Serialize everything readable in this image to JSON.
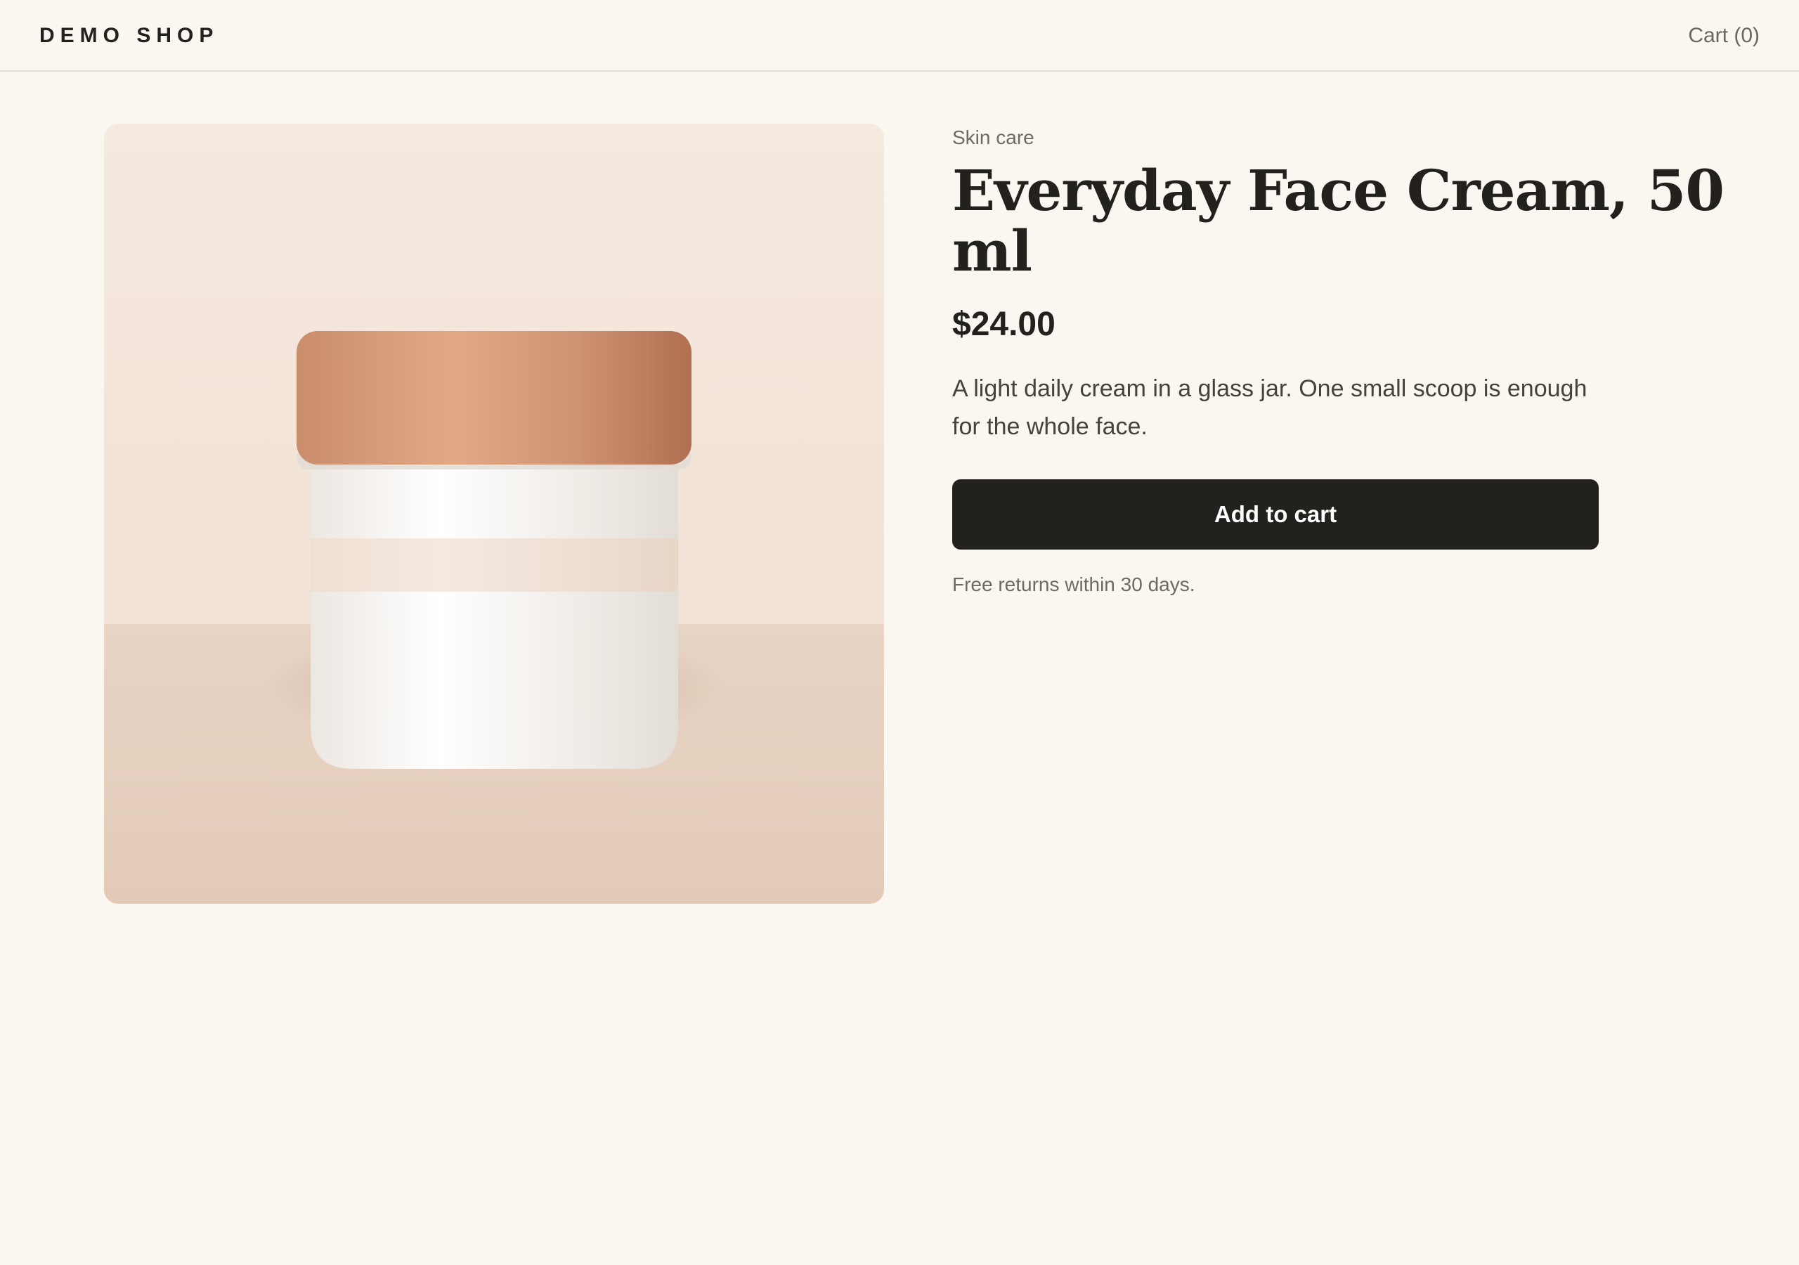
{
  "header": {
    "brand": "DEMO SHOP",
    "cart_label": "Cart (0)"
  },
  "product": {
    "category": "Skin care",
    "title": "Everyday Face Cream, 50 ml",
    "price": "$24.00",
    "description": "A light daily cream in a glass jar. One small scoop is enough for the whole face.",
    "add_to_cart_label": "Add to cart",
    "returns_note": "Free returns within 30 days."
  },
  "colors": {
    "background": "#faf7f1",
    "text": "#22211d",
    "button": "#22211d",
    "muted": "#6e6a63",
    "lid": "#d4987a"
  }
}
